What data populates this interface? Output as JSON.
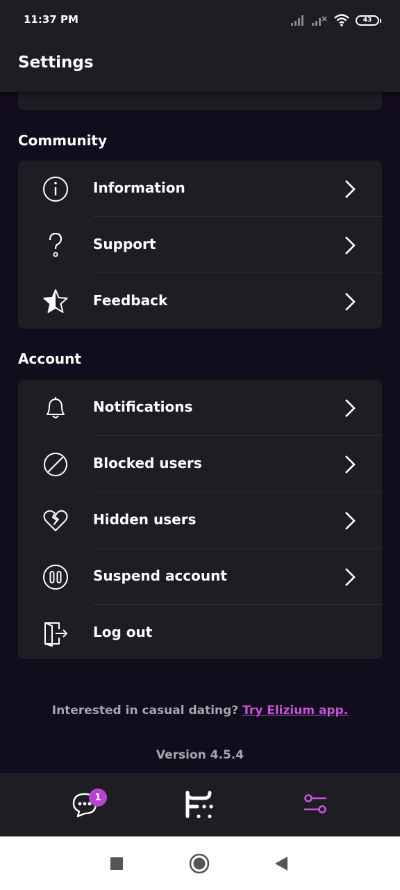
{
  "status_bar": {
    "time": "11:37 PM",
    "battery": "43"
  },
  "app_bar": {
    "title": "Settings"
  },
  "community": {
    "header": "Community",
    "items": [
      {
        "label": "Information",
        "icon": "info-icon"
      },
      {
        "label": "Support",
        "icon": "question-icon"
      },
      {
        "label": "Feedback",
        "icon": "star-icon"
      }
    ]
  },
  "account": {
    "header": "Account",
    "items": [
      {
        "label": "Notifications",
        "icon": "bell-icon"
      },
      {
        "label": "Blocked users",
        "icon": "block-icon"
      },
      {
        "label": "Hidden users",
        "icon": "broken-heart-icon"
      },
      {
        "label": "Suspend account",
        "icon": "pause-icon"
      },
      {
        "label": "Log out",
        "icon": "logout-icon"
      }
    ]
  },
  "promo": {
    "text": "Interested in casual dating?",
    "link": "Try Elizium app."
  },
  "version": "Version 4.5.4",
  "bottom_nav": {
    "chat_badge": "1",
    "accent_color": "#c455d8"
  }
}
